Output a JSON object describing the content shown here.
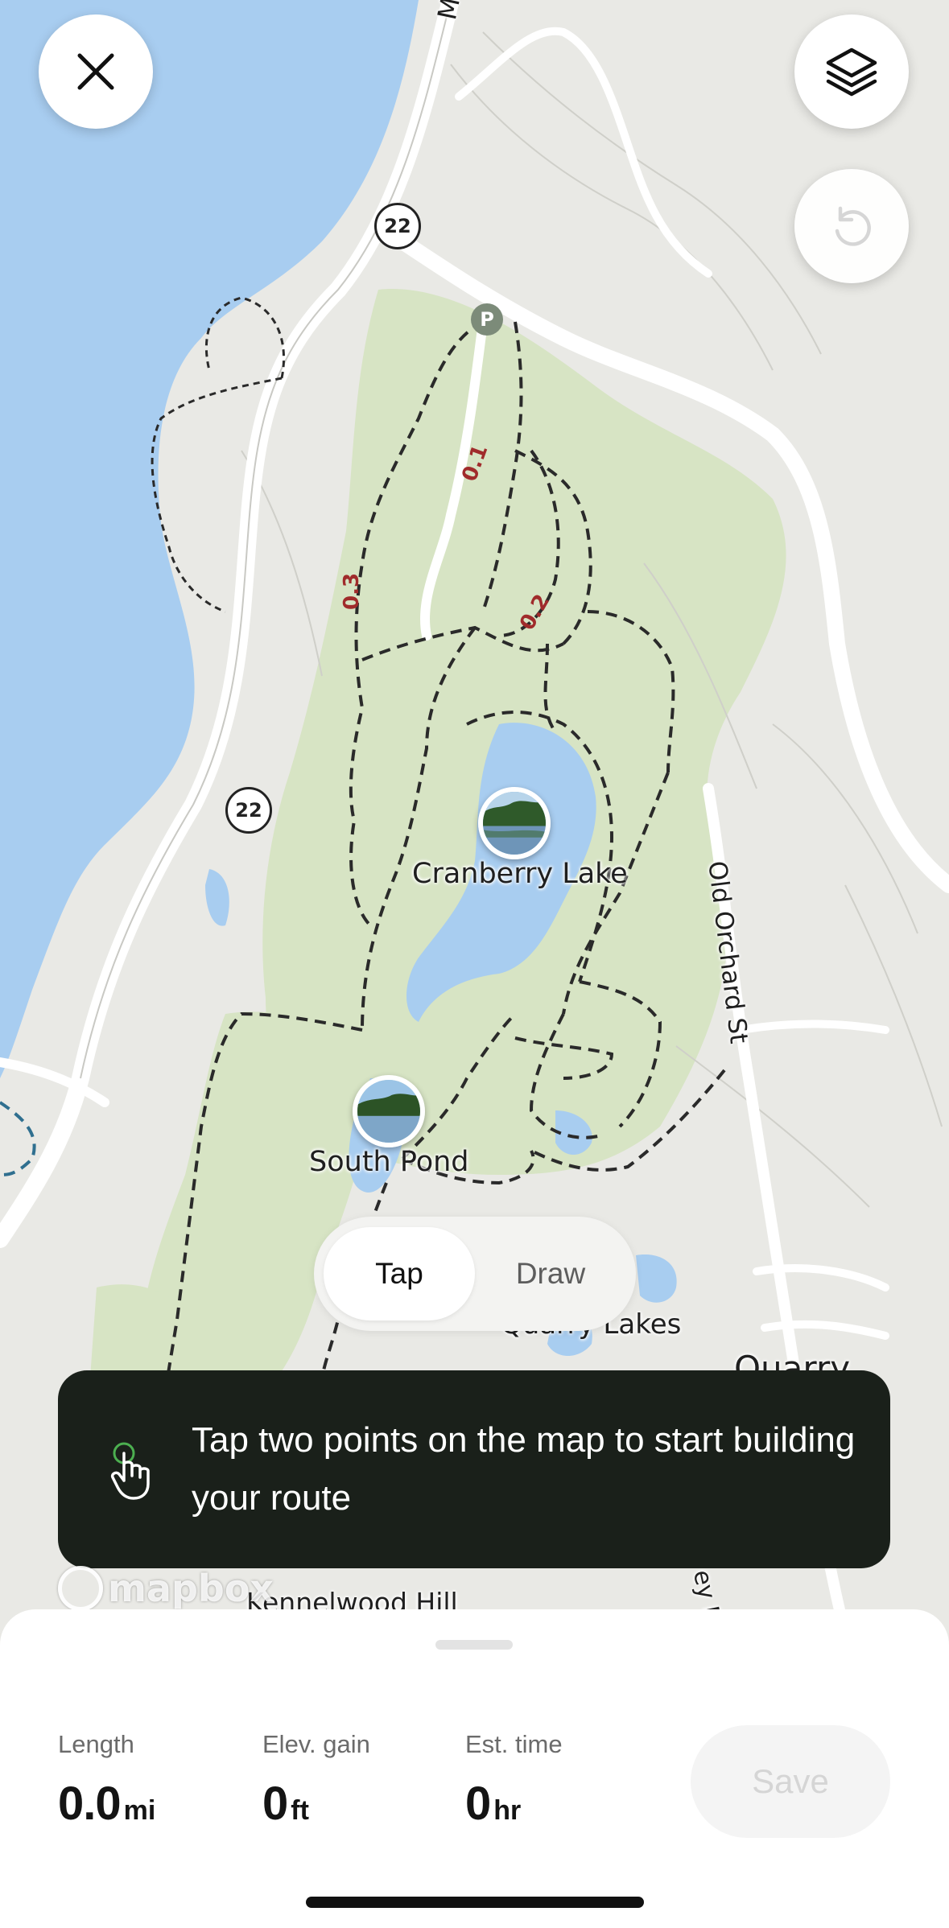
{
  "map": {
    "labels": {
      "cranberry_lake": "Cranberry Lake",
      "south_pond": "South Pond",
      "old_orchard_st": "Old Orchard St",
      "mt": "Mt",
      "quarry_lakes": "Quarry Lakes",
      "quarry": "Quarry",
      "kennelwood_hill": "Kennelwood Hill",
      "ey": "ey F"
    },
    "shields": {
      "route_22_a": "22",
      "route_22_b": "22"
    },
    "parking": "P",
    "distance_markers": {
      "m1": "0.1",
      "m2": "0.2",
      "m3": "0.3"
    },
    "attribution": "mapbox",
    "colors": {
      "water": "#a8cdf0",
      "park": "#d7e4c4",
      "land": "#e9e9e5",
      "trail": "#2a2a2a",
      "road": "#ffffff"
    }
  },
  "controls": {
    "close_icon": "close-icon",
    "layers_icon": "layers-icon",
    "undo_icon": "undo-icon"
  },
  "mode_toggle": {
    "tap_label": "Tap",
    "draw_label": "Draw",
    "selected": "Tap"
  },
  "toast": {
    "icon": "tap-hand-icon",
    "message": "Tap two points on the map to start building your route"
  },
  "stats": {
    "length": {
      "label": "Length",
      "value": "0.0",
      "unit": "mi"
    },
    "elev_gain": {
      "label": "Elev. gain",
      "value": "0",
      "unit": "ft"
    },
    "est_time": {
      "label": "Est. time",
      "value": "0",
      "unit": "hr"
    }
  },
  "save_label": "Save"
}
